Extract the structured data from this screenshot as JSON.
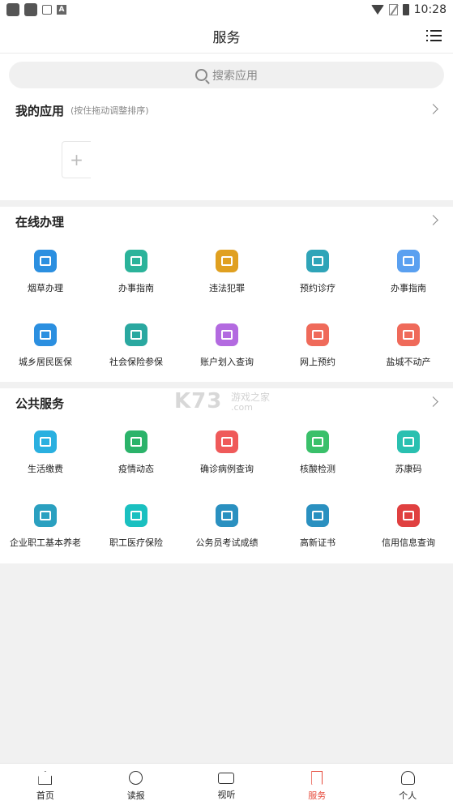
{
  "status_bar": {
    "time": "10:28"
  },
  "header": {
    "title": "服务"
  },
  "search": {
    "placeholder": "搜索应用"
  },
  "my_apps": {
    "title": "我的应用",
    "hint": "(按住拖动调整排序)",
    "add_symbol": "+"
  },
  "online": {
    "title": "在线办理",
    "rows": [
      [
        {
          "label": "烟草办理",
          "icon": "tobacco-card-icon",
          "color": "#2b8fe0"
        },
        {
          "label": "办事指南",
          "icon": "guide-book-icon",
          "color": "#2bb39a"
        },
        {
          "label": "违法犯罪",
          "icon": "police-icon",
          "color": "#e0a020"
        },
        {
          "label": "预约诊疗",
          "icon": "hospital-shield-icon",
          "color": "#2fa4b8"
        },
        {
          "label": "办事指南",
          "icon": "document-icon",
          "color": "#5aa0f0"
        }
      ],
      [
        {
          "label": "城乡居民医保",
          "icon": "id-card-icon",
          "color": "#2b8fe0"
        },
        {
          "label": "社会保险参保",
          "icon": "shield-icon",
          "color": "#2aa8a0"
        },
        {
          "label": "账户划入查询",
          "icon": "account-icon",
          "color": "#b36ae0"
        },
        {
          "label": "网上预约",
          "icon": "calendar-edit-icon",
          "color": "#ef6a5a"
        },
        {
          "label": "盐城不动产",
          "icon": "building-icon",
          "color": "#ef6a5a"
        }
      ]
    ]
  },
  "public": {
    "title": "公共服务",
    "rows": [
      [
        {
          "label": "生活缴费",
          "icon": "payment-icon",
          "color": "#2ab0e0"
        },
        {
          "label": "疫情动态",
          "icon": "epidemic-icon",
          "color": "#2bb36a"
        },
        {
          "label": "确诊病例查询",
          "icon": "virus-icon",
          "color": "#ef5a5a"
        },
        {
          "label": "核酸检测",
          "icon": "test-tube-icon",
          "color": "#3ac06a"
        },
        {
          "label": "苏康码",
          "icon": "health-code-icon",
          "color": "#2ac0b0"
        }
      ],
      [
        {
          "label": "企业职工基本养老",
          "icon": "pension-icon",
          "color": "#2aa0c0"
        },
        {
          "label": "职工医疗保险",
          "icon": "medical-list-icon",
          "color": "#1ac0c0"
        },
        {
          "label": "公务员考试成绩",
          "icon": "exam-icon",
          "color": "#2a90c0"
        },
        {
          "label": "高新证书",
          "icon": "certificate-icon",
          "color": "#2a90c0"
        },
        {
          "label": "信用信息查询",
          "icon": "credit-icon",
          "color": "#e04040"
        }
      ]
    ]
  },
  "watermark": {
    "main": "K73",
    "sub": "游戏之家",
    "domain": ".com"
  },
  "bottom_nav": [
    {
      "label": "首页",
      "icon": "home-icon",
      "active": false
    },
    {
      "label": "读报",
      "icon": "compass-icon",
      "active": false
    },
    {
      "label": "视听",
      "icon": "video-icon",
      "active": false
    },
    {
      "label": "服务",
      "icon": "bookmark-icon",
      "active": true
    },
    {
      "label": "个人",
      "icon": "person-icon",
      "active": false
    }
  ],
  "colors": {
    "accent": "#e64a3b",
    "background": "#f1f1f1"
  }
}
